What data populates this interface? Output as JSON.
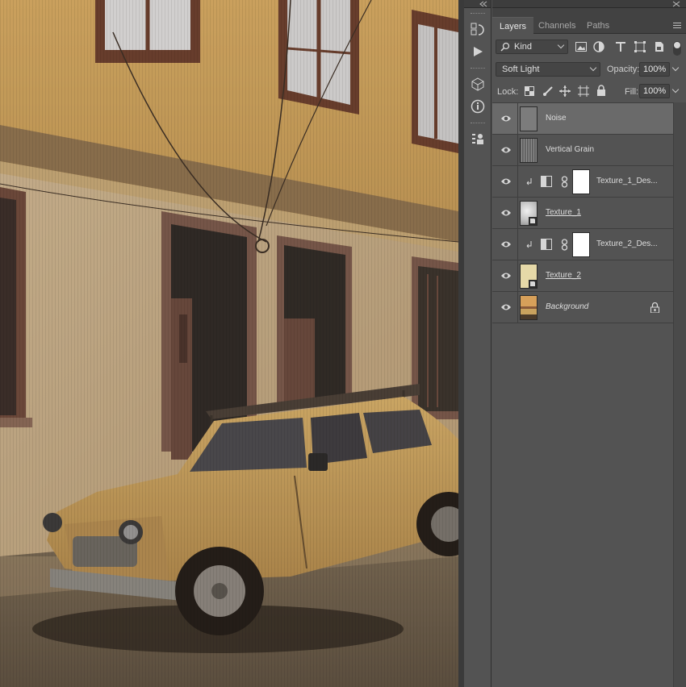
{
  "panel": {
    "tabs": [
      {
        "label": "Layers",
        "active": true
      },
      {
        "label": "Channels",
        "active": false
      },
      {
        "label": "Paths",
        "active": false
      }
    ],
    "filter": {
      "label": "Kind"
    },
    "blend_mode": "Soft Light",
    "opacity_label": "Opacity:",
    "opacity_value": "100%",
    "lock_label": "Lock:",
    "fill_label": "Fill:",
    "fill_value": "100%"
  },
  "layers": [
    {
      "name": "Noise",
      "selected": true,
      "style": "plain",
      "thumb": "gray"
    },
    {
      "name": "Vertical Grain",
      "selected": false,
      "style": "plain",
      "thumb": "grain"
    },
    {
      "name": "Texture_1_Des...",
      "selected": false,
      "style": "adjustment",
      "thumb": "adjustment"
    },
    {
      "name": "Texture_1",
      "selected": false,
      "style": "underline",
      "thumb": "texture1"
    },
    {
      "name": "Texture_2_Des...",
      "selected": false,
      "style": "adjustment",
      "thumb": "adjustment"
    },
    {
      "name": "Texture_2",
      "selected": false,
      "style": "underline",
      "thumb": "texture2"
    },
    {
      "name": "Background",
      "selected": false,
      "style": "italic",
      "thumb": "photo",
      "locked": true
    }
  ],
  "colors": {
    "panel_bg": "#535353",
    "selected_row": "#6a6a6a",
    "text": "#dedede",
    "wall_ochre": "#c9a25e",
    "car_yellow": "#c9a35a"
  },
  "toolstrip_icons": [
    "history-icon",
    "play-actions-icon",
    "3d-cube-icon",
    "info-icon",
    "properties-icon"
  ]
}
